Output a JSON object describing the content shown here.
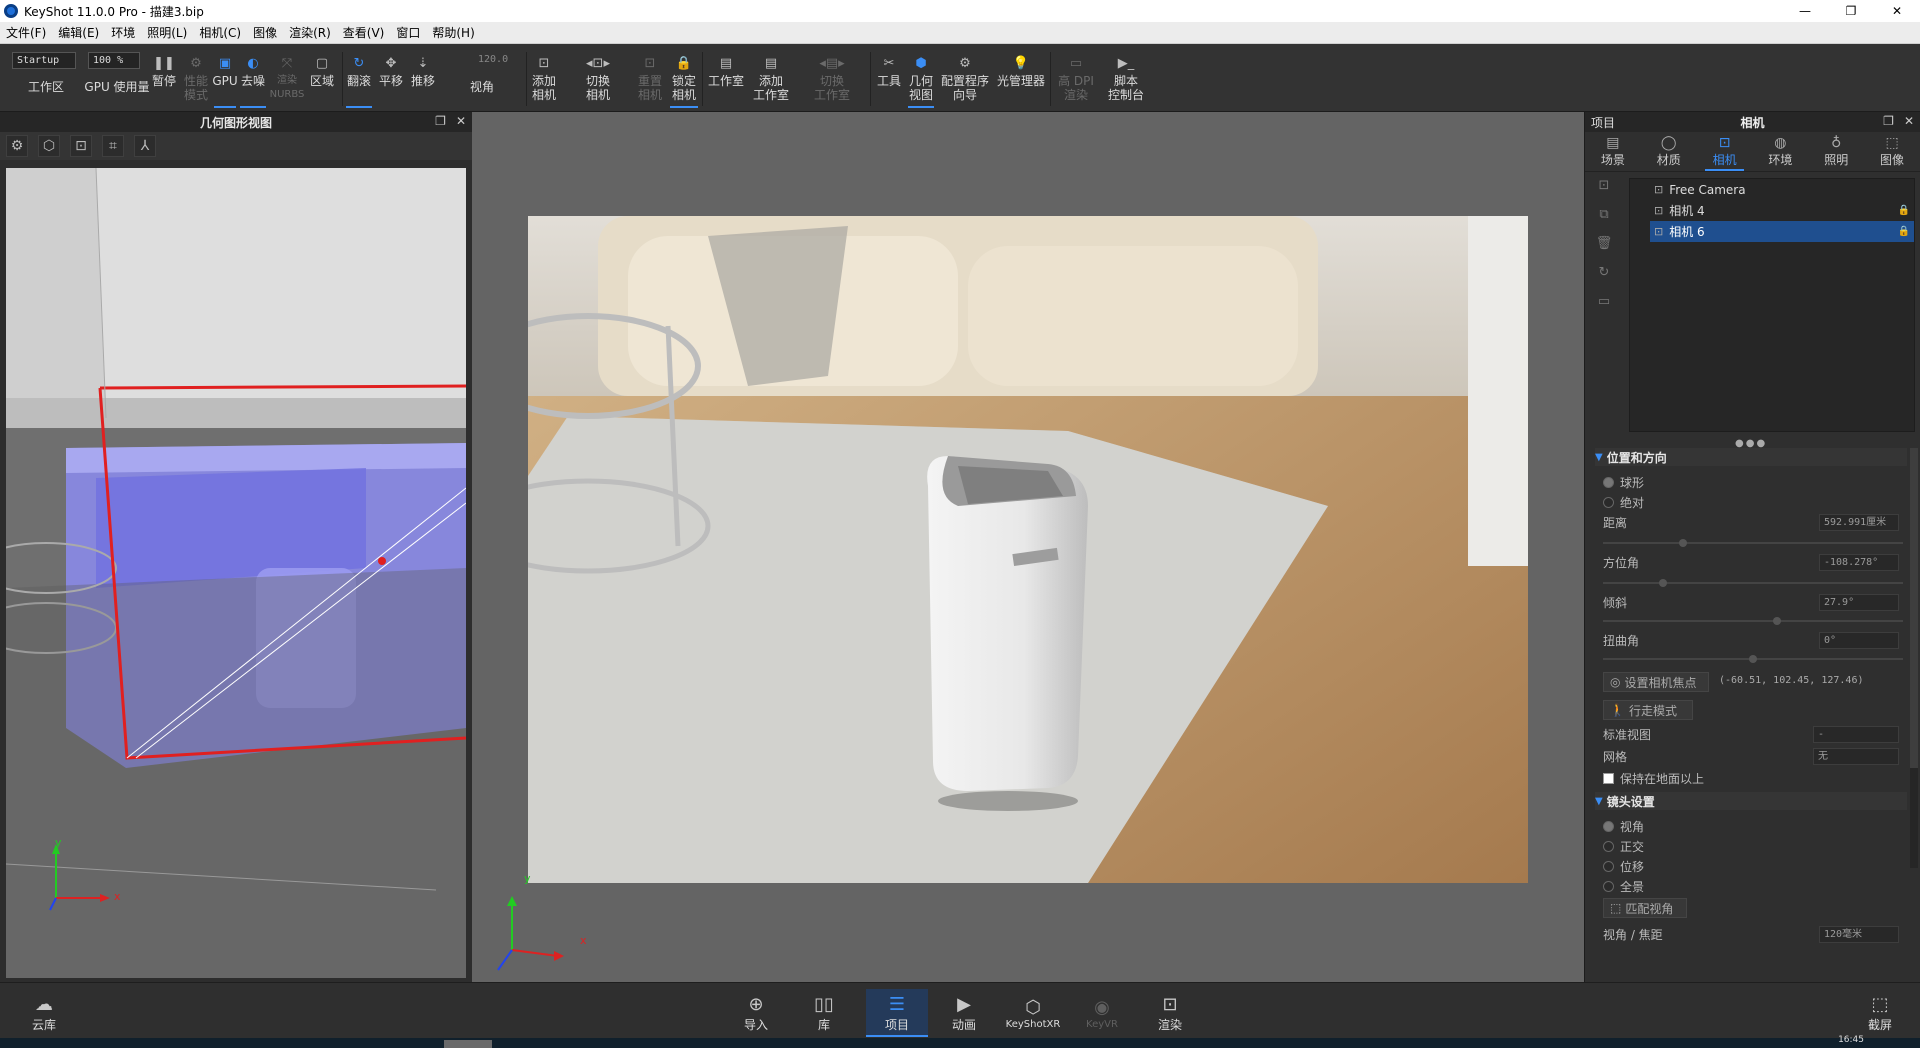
{
  "window": {
    "title": "KeyShot 11.0.0 Pro  - 描建3.bip",
    "minimize": "—",
    "restore": "❐",
    "close": "✕"
  },
  "menu": [
    "文件(F)",
    "编辑(E)",
    "环境",
    "照明(L)",
    "相机(C)",
    "图像",
    "渲染(R)",
    "查看(V)",
    "窗口",
    "帮助(H)"
  ],
  "toolbar": {
    "workspace_value": "Startup",
    "workspace_label": "工作区",
    "zoom_value": "100 %",
    "gpu_usage": "GPU 使用量",
    "pause": "暂停",
    "perf_mode": "性能\n模式",
    "gpu": "GPU",
    "denoise": "去噪",
    "render_nurbs": "渲染\nNURBS",
    "region": "区域",
    "tumble": "翻滚",
    "pan": "平移",
    "dolly": "推移",
    "fov_value": "120.0",
    "fov": "视角",
    "add_camera": "添加\n相机",
    "switch_camera": "切换\n相机",
    "reset_camera": "重置\n相机",
    "lock_camera": "锁定\n相机",
    "studio": "工作室",
    "add_studio": "添加\n工作室",
    "switch_studio": "切换\n工作室",
    "tools": "工具",
    "geometry_view": "几何\n视图",
    "config_wizard": "配置程序\n向导",
    "light_manager": "光管理器",
    "hidpi_render": "高 DPI\n渲染",
    "script_console": "脚本\n控制台"
  },
  "geometry_panel": {
    "title": "几何图形视图",
    "axis_y": "y",
    "axis_x": "x"
  },
  "viewport": {
    "axis_y": "y",
    "axis_x": "x"
  },
  "project_panel": {
    "header_left": "项目",
    "header_title": "相机",
    "tabs": [
      "场景",
      "材质",
      "相机",
      "环境",
      "照明",
      "图像"
    ],
    "cameras": [
      "Free Camera",
      "相机 4",
      "相机 6"
    ],
    "section_position": "位置和方向",
    "spherical": "球形",
    "absolute": "绝对",
    "distance_label": "距离",
    "distance_value": "592.991厘米",
    "azimuth_label": "方位角",
    "azimuth_value": "-108.278°",
    "inclination_label": "倾斜",
    "inclination_value": "27.9°",
    "twist_label": "扭曲角",
    "twist_value": "0°",
    "set_focus": "设置相机焦点",
    "focus_coords": "(-60.51, 102.45, 127.46)",
    "walk_mode": "行走模式",
    "std_view_label": "标准视图",
    "std_view_value": "-",
    "grid_label": "网格",
    "grid_value": "无",
    "keep_above": "保持在地面以上",
    "section_lens": "镜头设置",
    "perspective": "视角",
    "orthographic": "正交",
    "shift": "位移",
    "panorama": "全景",
    "match_persp": "匹配视角",
    "fov_focal_label": "视角 / 焦距",
    "fov_focal_value": "120毫米"
  },
  "bottom": {
    "cloud": "云库",
    "import": "导入",
    "library": "库",
    "project": "项目",
    "animation": "动画",
    "keyshotxr": "KeyShotXR",
    "keyvr": "KeyVR",
    "render": "渲染",
    "screenshot": "截屏"
  },
  "taskbar": {
    "time": "16:45"
  }
}
